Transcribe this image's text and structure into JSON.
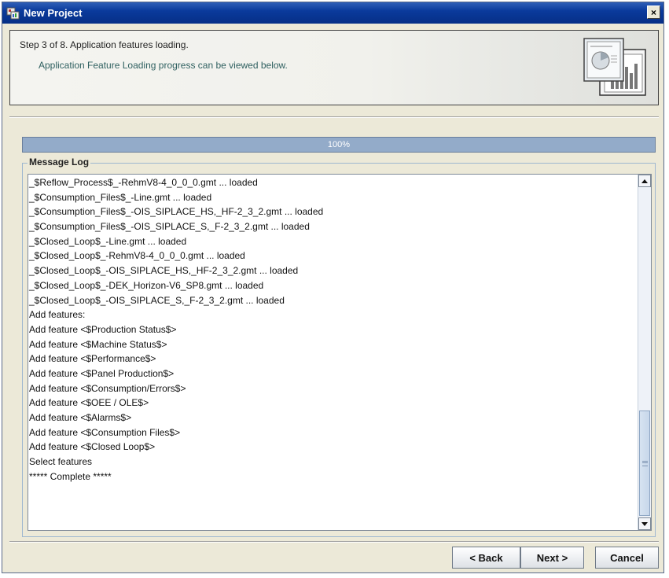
{
  "window": {
    "title": "New Project",
    "close_label": "×"
  },
  "header": {
    "step_text": "Step 3 of 8. Application features loading.",
    "sub_text": "Application Feature Loading progress can be viewed below."
  },
  "progress": {
    "label": "100%",
    "value": 1.0,
    "color": "#8ea6c4"
  },
  "message_log": {
    "legend": "Message Log",
    "lines": [
      "_$Reflow_Process$_-RehmV8-4_0_0_0.gmt ... loaded",
      "_$Consumption_Files$_-Line.gmt ... loaded",
      "_$Consumption_Files$_-OIS_SIPLACE_HS,_HF-2_3_2.gmt ... loaded",
      "_$Consumption_Files$_-OIS_SIPLACE_S,_F-2_3_2.gmt ... loaded",
      "_$Closed_Loop$_-Line.gmt ... loaded",
      "_$Closed_Loop$_-RehmV8-4_0_0_0.gmt ... loaded",
      "_$Closed_Loop$_-OIS_SIPLACE_HS,_HF-2_3_2.gmt ... loaded",
      "_$Closed_Loop$_-DEK_Horizon-V6_SP8.gmt ... loaded",
      "_$Closed_Loop$_-OIS_SIPLACE_S,_F-2_3_2.gmt ... loaded",
      "Add features:",
      "Add feature <$Production Status$>",
      "Add feature <$Machine Status$>",
      "Add feature <$Performance$>",
      "Add feature <$Panel Production$>",
      "Add feature <$Consumption/Errors$>",
      "Add feature <$OEE / OLE$>",
      "Add feature <$Alarms$>",
      "Add feature <$Consumption Files$>",
      "Add feature <$Closed Loop$>",
      "Select features",
      "***** Complete *****"
    ]
  },
  "buttons": {
    "back": "< Back",
    "next": "Next >",
    "cancel": "Cancel"
  },
  "icons": {
    "app": "project-wizard-icon",
    "header": "chart-document-icon"
  }
}
